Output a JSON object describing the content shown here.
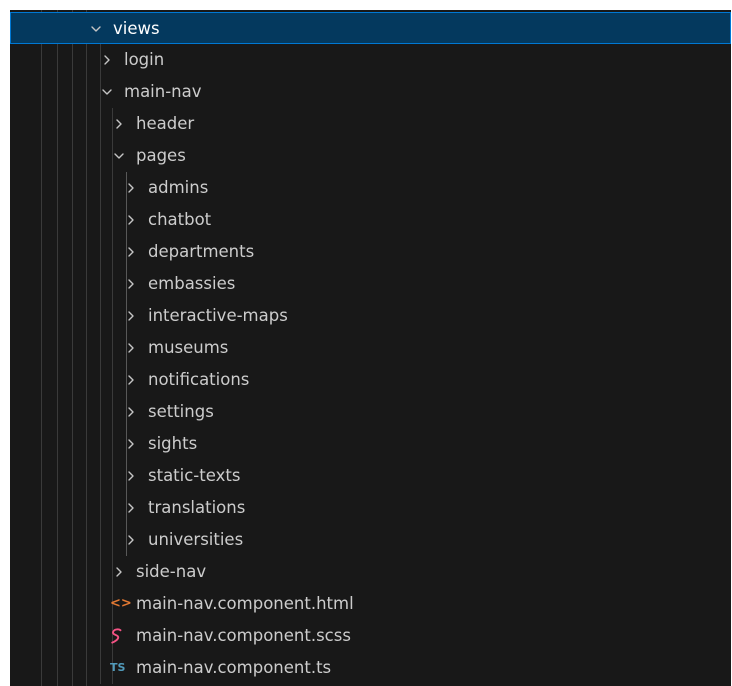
{
  "explorer": {
    "tree": [
      {
        "label": "views",
        "depth": 0,
        "expanded": true,
        "kind": "folder",
        "selected": true
      },
      {
        "label": "login",
        "depth": 1,
        "expanded": false,
        "kind": "folder"
      },
      {
        "label": "main-nav",
        "depth": 1,
        "expanded": true,
        "kind": "folder"
      },
      {
        "label": "header",
        "depth": 2,
        "expanded": false,
        "kind": "folder"
      },
      {
        "label": "pages",
        "depth": 2,
        "expanded": true,
        "kind": "folder"
      },
      {
        "label": "admins",
        "depth": 3,
        "expanded": false,
        "kind": "folder"
      },
      {
        "label": "chatbot",
        "depth": 3,
        "expanded": false,
        "kind": "folder"
      },
      {
        "label": "departments",
        "depth": 3,
        "expanded": false,
        "kind": "folder"
      },
      {
        "label": "embassies",
        "depth": 3,
        "expanded": false,
        "kind": "folder"
      },
      {
        "label": "interactive-maps",
        "depth": 3,
        "expanded": false,
        "kind": "folder"
      },
      {
        "label": "museums",
        "depth": 3,
        "expanded": false,
        "kind": "folder"
      },
      {
        "label": "notifications",
        "depth": 3,
        "expanded": false,
        "kind": "folder"
      },
      {
        "label": "settings",
        "depth": 3,
        "expanded": false,
        "kind": "folder"
      },
      {
        "label": "sights",
        "depth": 3,
        "expanded": false,
        "kind": "folder"
      },
      {
        "label": "static-texts",
        "depth": 3,
        "expanded": false,
        "kind": "folder"
      },
      {
        "label": "translations",
        "depth": 3,
        "expanded": false,
        "kind": "folder"
      },
      {
        "label": "universities",
        "depth": 3,
        "expanded": false,
        "kind": "folder"
      },
      {
        "label": "side-nav",
        "depth": 2,
        "expanded": false,
        "kind": "folder"
      },
      {
        "label": "main-nav.component.html",
        "depth": 2,
        "kind": "file",
        "icon": "html-icon",
        "icon_text": "<>",
        "icon_color": "#e37933"
      },
      {
        "label": "main-nav.component.scss",
        "depth": 2,
        "kind": "file",
        "icon": "sass-icon",
        "icon_color": "#f55385"
      },
      {
        "label": "main-nav.component.ts",
        "depth": 2,
        "kind": "file",
        "icon": "typescript-icon",
        "icon_text": "TS",
        "icon_color": "#519aba"
      }
    ]
  }
}
